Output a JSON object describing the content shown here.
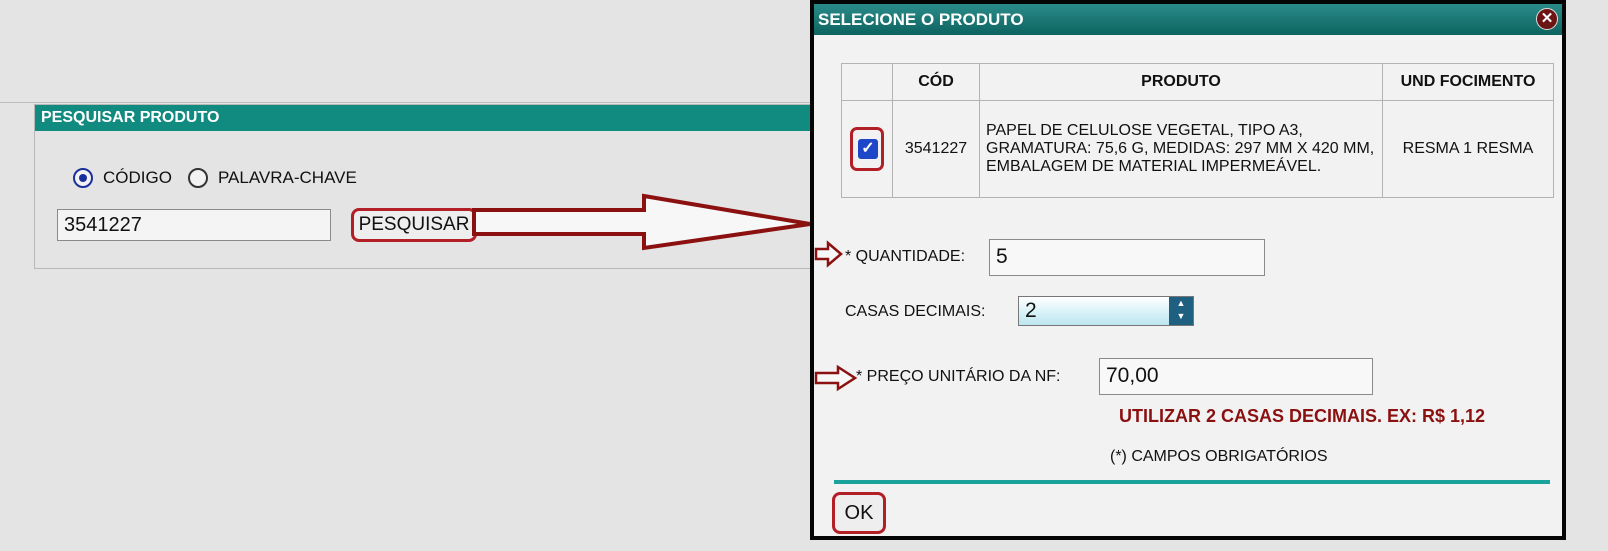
{
  "search_panel": {
    "title": "PESQUISAR PRODUTO",
    "radio_codigo_label": "CÓDIGO",
    "radio_palavra_label": "PALAVRA-CHAVE",
    "selected_mode": "CÓDIGO",
    "search_value": "3541227",
    "search_button_label": "PESQUISAR"
  },
  "dialog": {
    "title": "SELECIONE O PRODUTO",
    "close_glyph": "✕",
    "table": {
      "headers": [
        "",
        "CÓD",
        "PRODUTO",
        "UND FOCIMENTO"
      ],
      "rows": [
        {
          "checked": true,
          "check_glyph": "✓",
          "cod": "3541227",
          "produto": "PAPEL DE CELULOSE VEGETAL, TIPO A3, GRAMATURA: 75,6 G, MEDIDAS: 297 MM X 420 MM, EMBALAGEM DE MATERIAL IMPERMEÁVEL.",
          "und": "RESMA 1 RESMA"
        }
      ]
    },
    "quantidade_label": "* QUANTIDADE:",
    "quantidade_value": "5",
    "casas_label": "CASAS DECIMAIS:",
    "casas_value": "2",
    "spin_up": "▲",
    "spin_down": "▼",
    "preco_label": "* PREÇO UNITÁRIO DA NF:",
    "preco_value": "70,00",
    "hint": "UTILIZAR 2 CASAS DECIMAIS. EX: R$ 1,12",
    "required_note": "(*) CAMPOS OBRIGATÓRIOS",
    "ok_label": "OK"
  },
  "colors": {
    "panel_header": "#118a80",
    "highlight_red": "#b21f27",
    "hint_red": "#8b1010",
    "checkbox_blue": "#1e46c8"
  }
}
